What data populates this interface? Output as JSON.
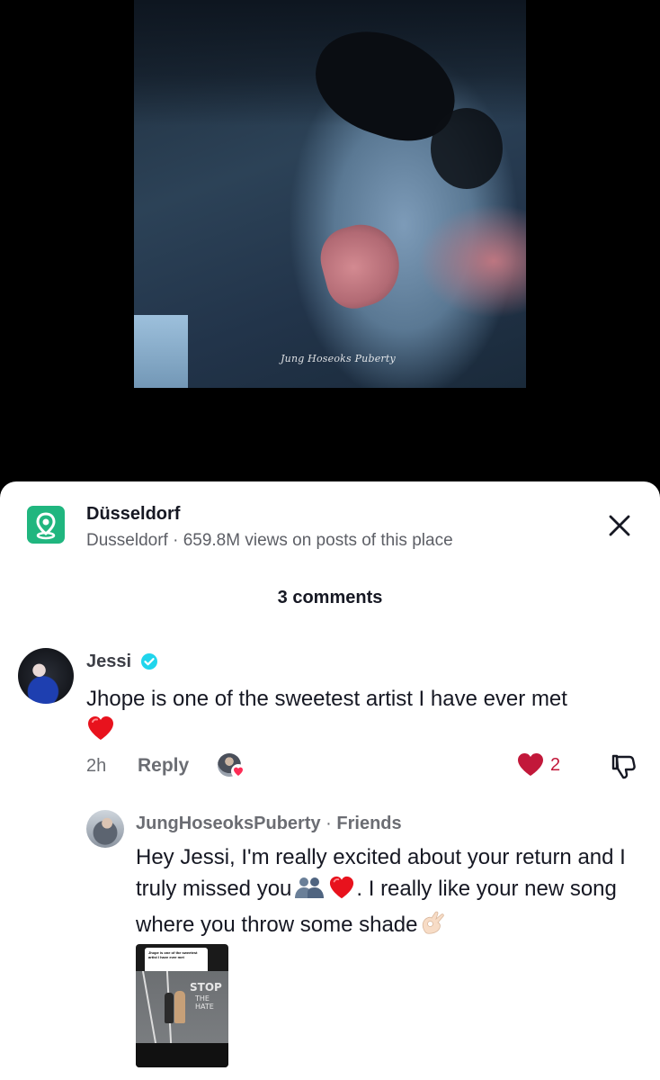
{
  "video": {
    "watermark": "Jung Hoseoks Puberty"
  },
  "place": {
    "name": "Düsseldorf",
    "subtitle": "Dusseldorf · 659.8M views on posts of this place",
    "icon": "location-pin-icon"
  },
  "comments_header": "3 comments",
  "comments": [
    {
      "username": "Jessi",
      "verified": true,
      "text": "Jhope is one of the sweetest artist I have ever met",
      "emoji": "red-heart",
      "time": "2h",
      "reply_label": "Reply",
      "likes": "2",
      "liked_by_creator": true
    },
    {
      "username": "JungHoseoksPuberty",
      "relation": "Friends",
      "separator": " · ",
      "text_part1": "Hey Jessi, I'm really excited about your return and I truly missed you",
      "text_part2": ". I really like your new song where you throw some shade",
      "thumbnail": {
        "card_text": "Jhope is one of the sweetest artist I have ever met",
        "sign_line1": "STOP",
        "sign_line2": "THE HATE"
      }
    }
  ],
  "colors": {
    "accent_like": "#c2183a",
    "place_icon": "#20b67f",
    "verified": "#20d5ec"
  }
}
